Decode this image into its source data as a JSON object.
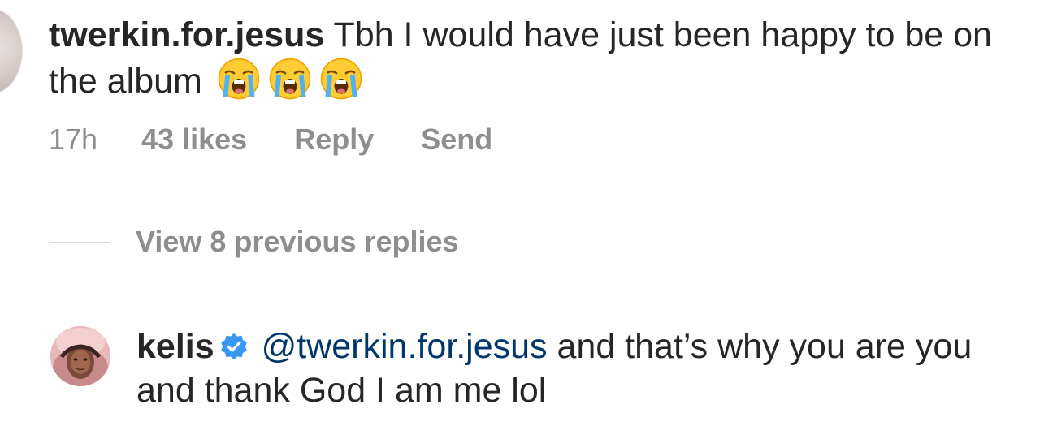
{
  "comment": {
    "username": "twerkin.for.jesus",
    "text": "Tbh I would have just been happy to be on the album",
    "emoji": [
      "loudly-crying-face",
      "loudly-crying-face",
      "loudly-crying-face"
    ],
    "time": "17h",
    "likes": "43 likes",
    "reply_label": "Reply",
    "send_label": "Send"
  },
  "thread": {
    "view_replies_label": "View 8 previous replies"
  },
  "reply": {
    "username": "kelis",
    "verified": true,
    "mention": "@twerkin.for.jesus",
    "text": "and that’s why you are you and thank God I am me lol"
  },
  "colors": {
    "text": "#262626",
    "secondary": "#8e8e8e",
    "mention": "#00376b",
    "verified_blue": "#3897f0",
    "divider": "#dbdbdb"
  }
}
